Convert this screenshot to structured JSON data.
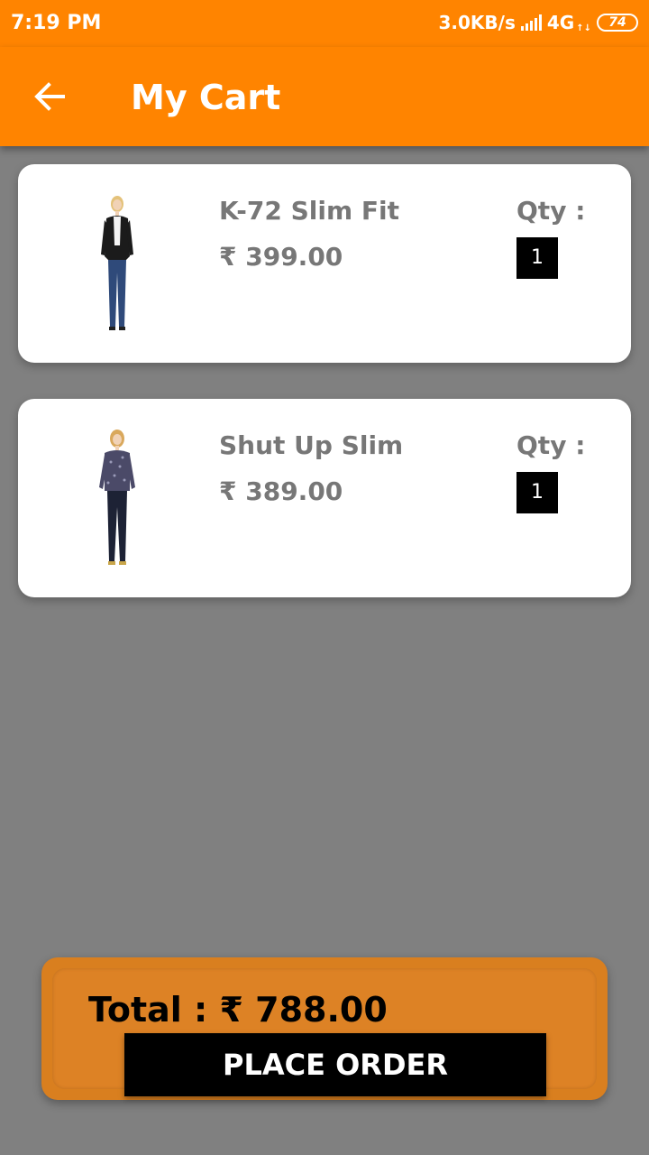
{
  "status_bar": {
    "time": "7:19 PM",
    "speed": "3.0KB/s",
    "network": "4G",
    "battery": "74"
  },
  "app_bar": {
    "title": "My Cart",
    "back_icon": "arrow-left-icon"
  },
  "cart": {
    "qty_label": "Qty :",
    "items": [
      {
        "name": "K-72 Slim Fit",
        "price": "₹ 399.00",
        "qty": "1",
        "image": "model-in-black-jacket-and-jeans"
      },
      {
        "name": "Shut Up Slim",
        "price": "₹ 389.00",
        "qty": "1",
        "image": "model-in-patterned-top-and-dark-jeans"
      }
    ]
  },
  "footer": {
    "total": "Total : ₹ 788.00",
    "place_order_label": "PLACE ORDER"
  },
  "colors": {
    "accent": "#FF8400",
    "footer": "#D97F1F",
    "background": "#808080"
  }
}
